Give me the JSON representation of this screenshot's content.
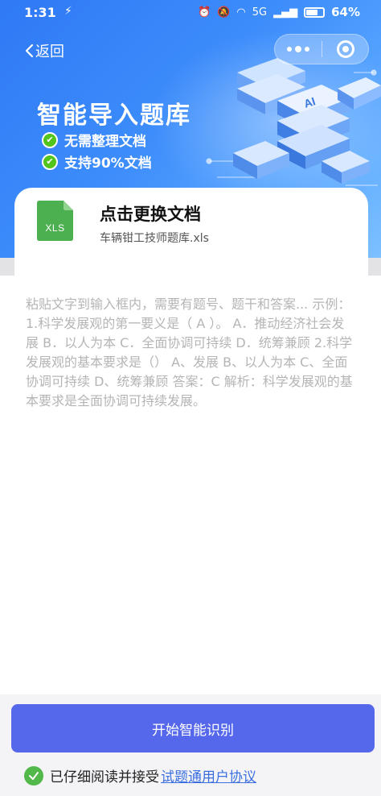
{
  "status_bar": {
    "time": "1:31",
    "network": "5G",
    "battery": "64%"
  },
  "nav": {
    "back_label": "返回"
  },
  "hero": {
    "title": "智能导入题库",
    "features": [
      "无需整理文档",
      "支持90%文档"
    ],
    "art_badge": "AI"
  },
  "file": {
    "type_label": "XLS",
    "action_title": "点击更换文档",
    "file_name": "车辆钳工技师题库.xls"
  },
  "input": {
    "placeholder": "粘贴文字到输入框内，需要有题号、题干和答案... 示例： 1.科学发展观的第一要义是（ A ）。 A．推动经济社会发展 B．以人为本 C．全面协调可持续 D．统筹兼顾 2.科学发展观的基本要求是（） A、发展 B、以人为本 C、全面协调可持续 D、统筹兼顾 答案：C 解析：科学发展观的基本要求是全面协调可持续发展。",
    "value": ""
  },
  "actions": {
    "start_label": "开始智能识别",
    "agree_text": "已仔细阅读并接受",
    "agree_link": "试题通用户协议"
  },
  "colors": {
    "hero_blue": "#3d8dfb",
    "button": "#5568ec",
    "xls_green": "#4caf50",
    "check_green": "#52b84a",
    "link": "#3b6fe0"
  }
}
